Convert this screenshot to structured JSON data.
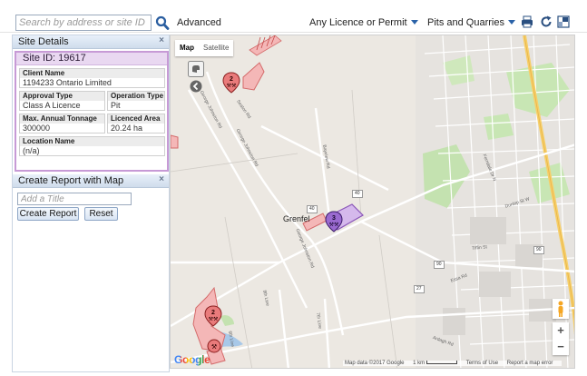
{
  "toolbar": {
    "search_placeholder": "Search by address or site ID",
    "advanced_label": "Advanced",
    "licence_filter": "Any Licence or Permit",
    "type_filter": "Pits and Quarries"
  },
  "site_details": {
    "header": "Site Details",
    "close": "×",
    "site_id_label": "Site ID: 19617",
    "fields": {
      "client_name": {
        "label": "Client Name",
        "value": "1194233 Ontario Limited"
      },
      "approval_type": {
        "label": "Approval Type",
        "value": "Class A Licence"
      },
      "operation_type": {
        "label": "Operation Type",
        "value": "Pit"
      },
      "max_tonnage": {
        "label": "Max. Annual Tonnage",
        "value": "300000"
      },
      "licenced_area": {
        "label": "Licenced Area",
        "value": "20.24 ha"
      },
      "location_name": {
        "label": "Location Name",
        "value": "(n/a)"
      }
    }
  },
  "report": {
    "header": "Create Report with Map",
    "close": "×",
    "title_placeholder": "Add a Title",
    "create_button": "Create Report",
    "reset_button": "Reset"
  },
  "map": {
    "map_type_map": "Map",
    "map_type_satellite": "Satellite",
    "zoom_in": "+",
    "zoom_out": "−",
    "town": "Grenfel",
    "markers": [
      {
        "count": "2"
      },
      {
        "count": "3"
      },
      {
        "count": "2"
      }
    ],
    "road_labels": {
      "george_johnston_1": "George Johnston Rd",
      "george_johnston_2": "George Johnston Rd",
      "george_johnston_3": "George Johnston Rd",
      "seaton": "Seaton Rd",
      "bayview": "Bayview Rd",
      "line_8": "8th Line",
      "line_7": "7th Line",
      "line_6": "6th Line",
      "ardagh": "Ardagh Rd",
      "tiffin": "Tiffin St",
      "ferndale": "Ferndale Dr N",
      "dunlop": "Dunlop St W",
      "essa": "Essa Rd"
    },
    "highway_shields": {
      "h40a": "40",
      "h40b": "40",
      "h90a": "90",
      "h90b": "90",
      "h27": "27"
    },
    "attribution": {
      "map_data": "Map data ©2017 Google",
      "scale": "1 km",
      "terms": "Terms of Use",
      "report_error": "Report a map error"
    },
    "google": "Google"
  }
}
